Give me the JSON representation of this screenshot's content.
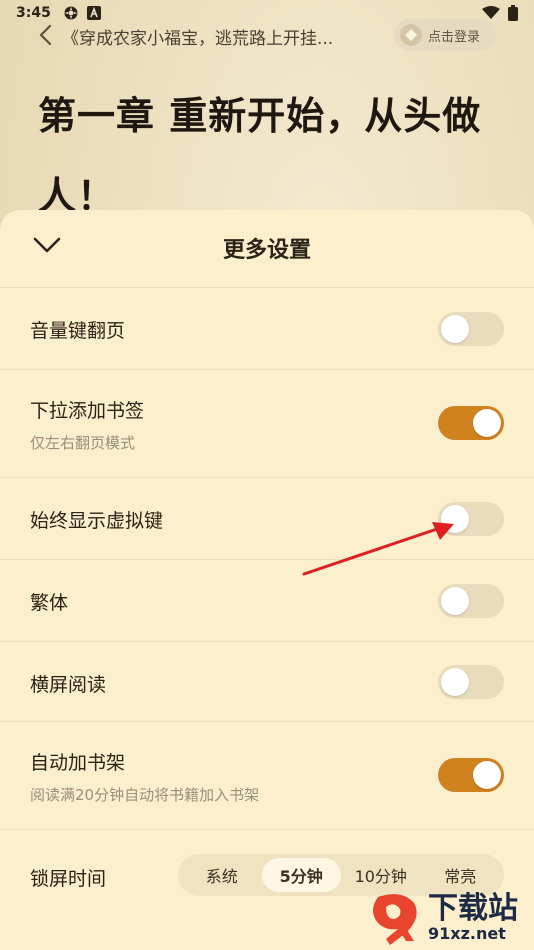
{
  "status_bar": {
    "time": "3:45",
    "icons": [
      "settings-icon",
      "a-icon",
      "wifi-icon",
      "battery-icon"
    ]
  },
  "top_bar": {
    "back_icon": "chevron-left-icon",
    "book_title": "《穿成农家小福宝，逃荒路上开挂...",
    "login_label": "点击登录",
    "login_icon": "diamond-icon"
  },
  "chapter": {
    "line1": "第一章 重新开始，从头做",
    "line2": "人！"
  },
  "sheet": {
    "title": "更多设置",
    "collapse_icon": "chevron-down-icon",
    "rows": [
      {
        "label": "音量键翻页",
        "sub": "",
        "on": false
      },
      {
        "label": "下拉添加书签",
        "sub": "仅左右翻页模式",
        "on": true
      },
      {
        "label": "始终显示虚拟键",
        "sub": "",
        "on": false
      },
      {
        "label": "繁体",
        "sub": "",
        "on": false
      },
      {
        "label": "横屏阅读",
        "sub": "",
        "on": false
      },
      {
        "label": "自动加书架",
        "sub": "阅读满20分钟自动将书籍加入书架",
        "on": true
      }
    ],
    "lock_screen": {
      "label": "锁屏时间",
      "options": [
        "系统",
        "5分钟",
        "10分钟",
        "常亮"
      ],
      "selected": "5分钟"
    }
  },
  "annotation": {
    "arrow_color": "#e02020"
  },
  "watermark": {
    "main": "下载站",
    "url": "91xz.net"
  },
  "colors": {
    "accent": "#d0821f",
    "sheet_bg": "#fbefcd"
  }
}
